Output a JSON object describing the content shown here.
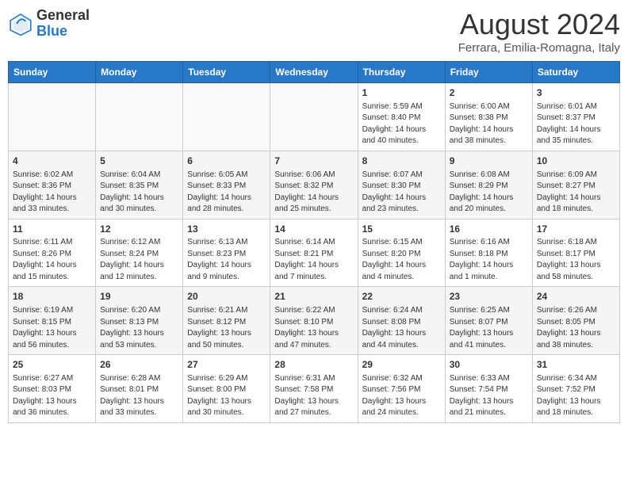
{
  "header": {
    "logo_general": "General",
    "logo_blue": "Blue",
    "month_title": "August 2024",
    "location": "Ferrara, Emilia-Romagna, Italy"
  },
  "weekdays": [
    "Sunday",
    "Monday",
    "Tuesday",
    "Wednesday",
    "Thursday",
    "Friday",
    "Saturday"
  ],
  "weeks": [
    [
      {
        "num": "",
        "info": ""
      },
      {
        "num": "",
        "info": ""
      },
      {
        "num": "",
        "info": ""
      },
      {
        "num": "",
        "info": ""
      },
      {
        "num": "1",
        "info": "Sunrise: 5:59 AM\nSunset: 8:40 PM\nDaylight: 14 hours\nand 40 minutes."
      },
      {
        "num": "2",
        "info": "Sunrise: 6:00 AM\nSunset: 8:38 PM\nDaylight: 14 hours\nand 38 minutes."
      },
      {
        "num": "3",
        "info": "Sunrise: 6:01 AM\nSunset: 8:37 PM\nDaylight: 14 hours\nand 35 minutes."
      }
    ],
    [
      {
        "num": "4",
        "info": "Sunrise: 6:02 AM\nSunset: 8:36 PM\nDaylight: 14 hours\nand 33 minutes."
      },
      {
        "num": "5",
        "info": "Sunrise: 6:04 AM\nSunset: 8:35 PM\nDaylight: 14 hours\nand 30 minutes."
      },
      {
        "num": "6",
        "info": "Sunrise: 6:05 AM\nSunset: 8:33 PM\nDaylight: 14 hours\nand 28 minutes."
      },
      {
        "num": "7",
        "info": "Sunrise: 6:06 AM\nSunset: 8:32 PM\nDaylight: 14 hours\nand 25 minutes."
      },
      {
        "num": "8",
        "info": "Sunrise: 6:07 AM\nSunset: 8:30 PM\nDaylight: 14 hours\nand 23 minutes."
      },
      {
        "num": "9",
        "info": "Sunrise: 6:08 AM\nSunset: 8:29 PM\nDaylight: 14 hours\nand 20 minutes."
      },
      {
        "num": "10",
        "info": "Sunrise: 6:09 AM\nSunset: 8:27 PM\nDaylight: 14 hours\nand 18 minutes."
      }
    ],
    [
      {
        "num": "11",
        "info": "Sunrise: 6:11 AM\nSunset: 8:26 PM\nDaylight: 14 hours\nand 15 minutes."
      },
      {
        "num": "12",
        "info": "Sunrise: 6:12 AM\nSunset: 8:24 PM\nDaylight: 14 hours\nand 12 minutes."
      },
      {
        "num": "13",
        "info": "Sunrise: 6:13 AM\nSunset: 8:23 PM\nDaylight: 14 hours\nand 9 minutes."
      },
      {
        "num": "14",
        "info": "Sunrise: 6:14 AM\nSunset: 8:21 PM\nDaylight: 14 hours\nand 7 minutes."
      },
      {
        "num": "15",
        "info": "Sunrise: 6:15 AM\nSunset: 8:20 PM\nDaylight: 14 hours\nand 4 minutes."
      },
      {
        "num": "16",
        "info": "Sunrise: 6:16 AM\nSunset: 8:18 PM\nDaylight: 14 hours\nand 1 minute."
      },
      {
        "num": "17",
        "info": "Sunrise: 6:18 AM\nSunset: 8:17 PM\nDaylight: 13 hours\nand 58 minutes."
      }
    ],
    [
      {
        "num": "18",
        "info": "Sunrise: 6:19 AM\nSunset: 8:15 PM\nDaylight: 13 hours\nand 56 minutes."
      },
      {
        "num": "19",
        "info": "Sunrise: 6:20 AM\nSunset: 8:13 PM\nDaylight: 13 hours\nand 53 minutes."
      },
      {
        "num": "20",
        "info": "Sunrise: 6:21 AM\nSunset: 8:12 PM\nDaylight: 13 hours\nand 50 minutes."
      },
      {
        "num": "21",
        "info": "Sunrise: 6:22 AM\nSunset: 8:10 PM\nDaylight: 13 hours\nand 47 minutes."
      },
      {
        "num": "22",
        "info": "Sunrise: 6:24 AM\nSunset: 8:08 PM\nDaylight: 13 hours\nand 44 minutes."
      },
      {
        "num": "23",
        "info": "Sunrise: 6:25 AM\nSunset: 8:07 PM\nDaylight: 13 hours\nand 41 minutes."
      },
      {
        "num": "24",
        "info": "Sunrise: 6:26 AM\nSunset: 8:05 PM\nDaylight: 13 hours\nand 38 minutes."
      }
    ],
    [
      {
        "num": "25",
        "info": "Sunrise: 6:27 AM\nSunset: 8:03 PM\nDaylight: 13 hours\nand 36 minutes."
      },
      {
        "num": "26",
        "info": "Sunrise: 6:28 AM\nSunset: 8:01 PM\nDaylight: 13 hours\nand 33 minutes."
      },
      {
        "num": "27",
        "info": "Sunrise: 6:29 AM\nSunset: 8:00 PM\nDaylight: 13 hours\nand 30 minutes."
      },
      {
        "num": "28",
        "info": "Sunrise: 6:31 AM\nSunset: 7:58 PM\nDaylight: 13 hours\nand 27 minutes."
      },
      {
        "num": "29",
        "info": "Sunrise: 6:32 AM\nSunset: 7:56 PM\nDaylight: 13 hours\nand 24 minutes."
      },
      {
        "num": "30",
        "info": "Sunrise: 6:33 AM\nSunset: 7:54 PM\nDaylight: 13 hours\nand 21 minutes."
      },
      {
        "num": "31",
        "info": "Sunrise: 6:34 AM\nSunset: 7:52 PM\nDaylight: 13 hours\nand 18 minutes."
      }
    ]
  ]
}
